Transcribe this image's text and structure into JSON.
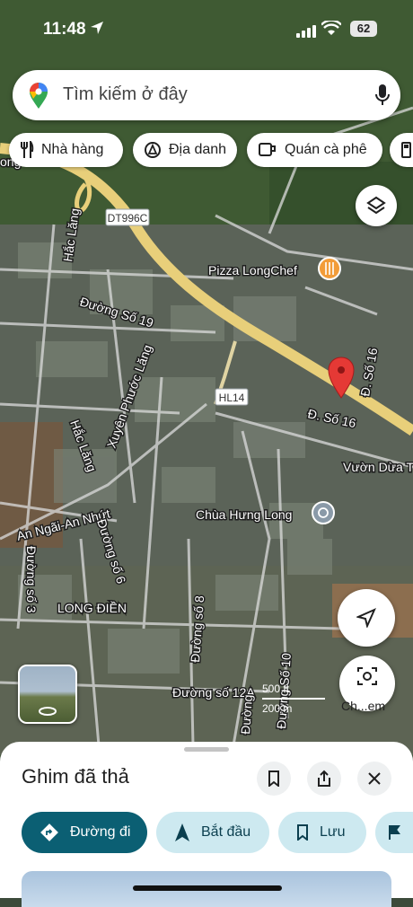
{
  "status_bar": {
    "time": "11:48",
    "battery": "62"
  },
  "search": {
    "placeholder": "Tìm kiếm ở đây"
  },
  "chips": [
    {
      "label": "Nhà hàng",
      "icon": "fork-knife-icon"
    },
    {
      "label": "Địa danh",
      "icon": "landmark-icon"
    },
    {
      "label": "Quán cà phê",
      "icon": "coffee-cup-icon"
    }
  ],
  "map": {
    "labels": {
      "dt996c": "DT996C",
      "hl14": "HL14",
      "pizza": "Pizza LongChef",
      "hac_lang_1": "Hắc Lăng",
      "hac_lang_2": "Hắc Lăng",
      "duong_so_19": "Đường Số 19",
      "xuyen_phuoc_lang": "Xuyên Phước Lăng",
      "d_so_16_a": "Đ. Số 16",
      "d_so_16_b": "Đ. Số 16",
      "vuon_dua": "Vườn Dừa T",
      "chua_hung_long": "Chùa Hưng Long",
      "an_ngai": "An Ngãi-An Nhứt",
      "duong_so_6": "Đường số 6",
      "duong_so_3": "Đường số 3",
      "long_dien": "LONG ĐIỀN",
      "duong_so_8": "Đường số 8",
      "duong_so_12a": "Đường số 12A",
      "duong_so_10": "Đường Số 10",
      "duong_partial": "Đường",
      "top_left_partial": "ong"
    },
    "scale": {
      "top": "500 ft",
      "bottom": "200 m"
    },
    "pin_color": "#e53935",
    "poi_color": "#f29c38",
    "road_color": "#e8cf7a"
  },
  "camera_label": "Ch...em",
  "sheet": {
    "title": "Ghim đã thả",
    "actions": [
      {
        "label": "Đường đi",
        "icon": "directions-icon"
      },
      {
        "label": "Bắt đầu",
        "icon": "navigation-arrow-icon"
      },
      {
        "label": "Lưu",
        "icon": "bookmark-icon"
      }
    ]
  },
  "colors": {
    "primary_button": "#0b5f73",
    "secondary_button": "#cde9f0"
  }
}
